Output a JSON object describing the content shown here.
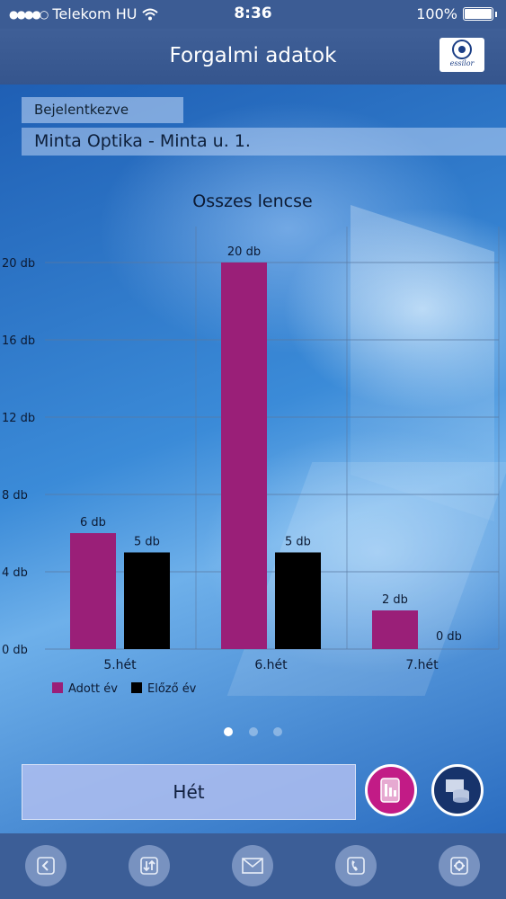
{
  "status_bar": {
    "carrier": "Telekom HU",
    "time": "8:36",
    "battery": "100%"
  },
  "header": {
    "title": "Forgalmi adatok",
    "logo_text": "essilor"
  },
  "login": {
    "label": "Bejelentkezve",
    "store": "Minta Optika - Minta u. 1."
  },
  "chart_data": {
    "type": "bar",
    "title": "Osszes lencse",
    "categories": [
      "5.hét",
      "6.hét",
      "7.hét"
    ],
    "series": [
      {
        "name": "Adott év",
        "values": [
          6,
          20,
          2
        ],
        "color": "#9a1f78"
      },
      {
        "name": "Előző év",
        "values": [
          5,
          5,
          0
        ],
        "color": "#000000"
      }
    ],
    "value_labels": [
      [
        "6 db",
        "20 db",
        "2 db"
      ],
      [
        "5 db",
        "5 db",
        "0 db"
      ]
    ],
    "y_ticks": [
      "0 db",
      "4 db",
      "8 db",
      "12 db",
      "16 db",
      "20 db"
    ],
    "ylim": [
      0,
      20
    ],
    "grid": true,
    "legend_position": "bottom-left"
  },
  "pager": {
    "count": 3,
    "active": 0
  },
  "period_button": {
    "label": "Hét"
  },
  "colors": {
    "accent_pink": "#c21b86",
    "navy": "#17336b",
    "header_bg": "#3c5c94"
  },
  "icons": {
    "left_button": "report-icon",
    "right_button": "database-icon",
    "tabs": [
      "back-icon",
      "sort-icon",
      "mail-icon",
      "phone-icon",
      "gear-icon"
    ]
  }
}
